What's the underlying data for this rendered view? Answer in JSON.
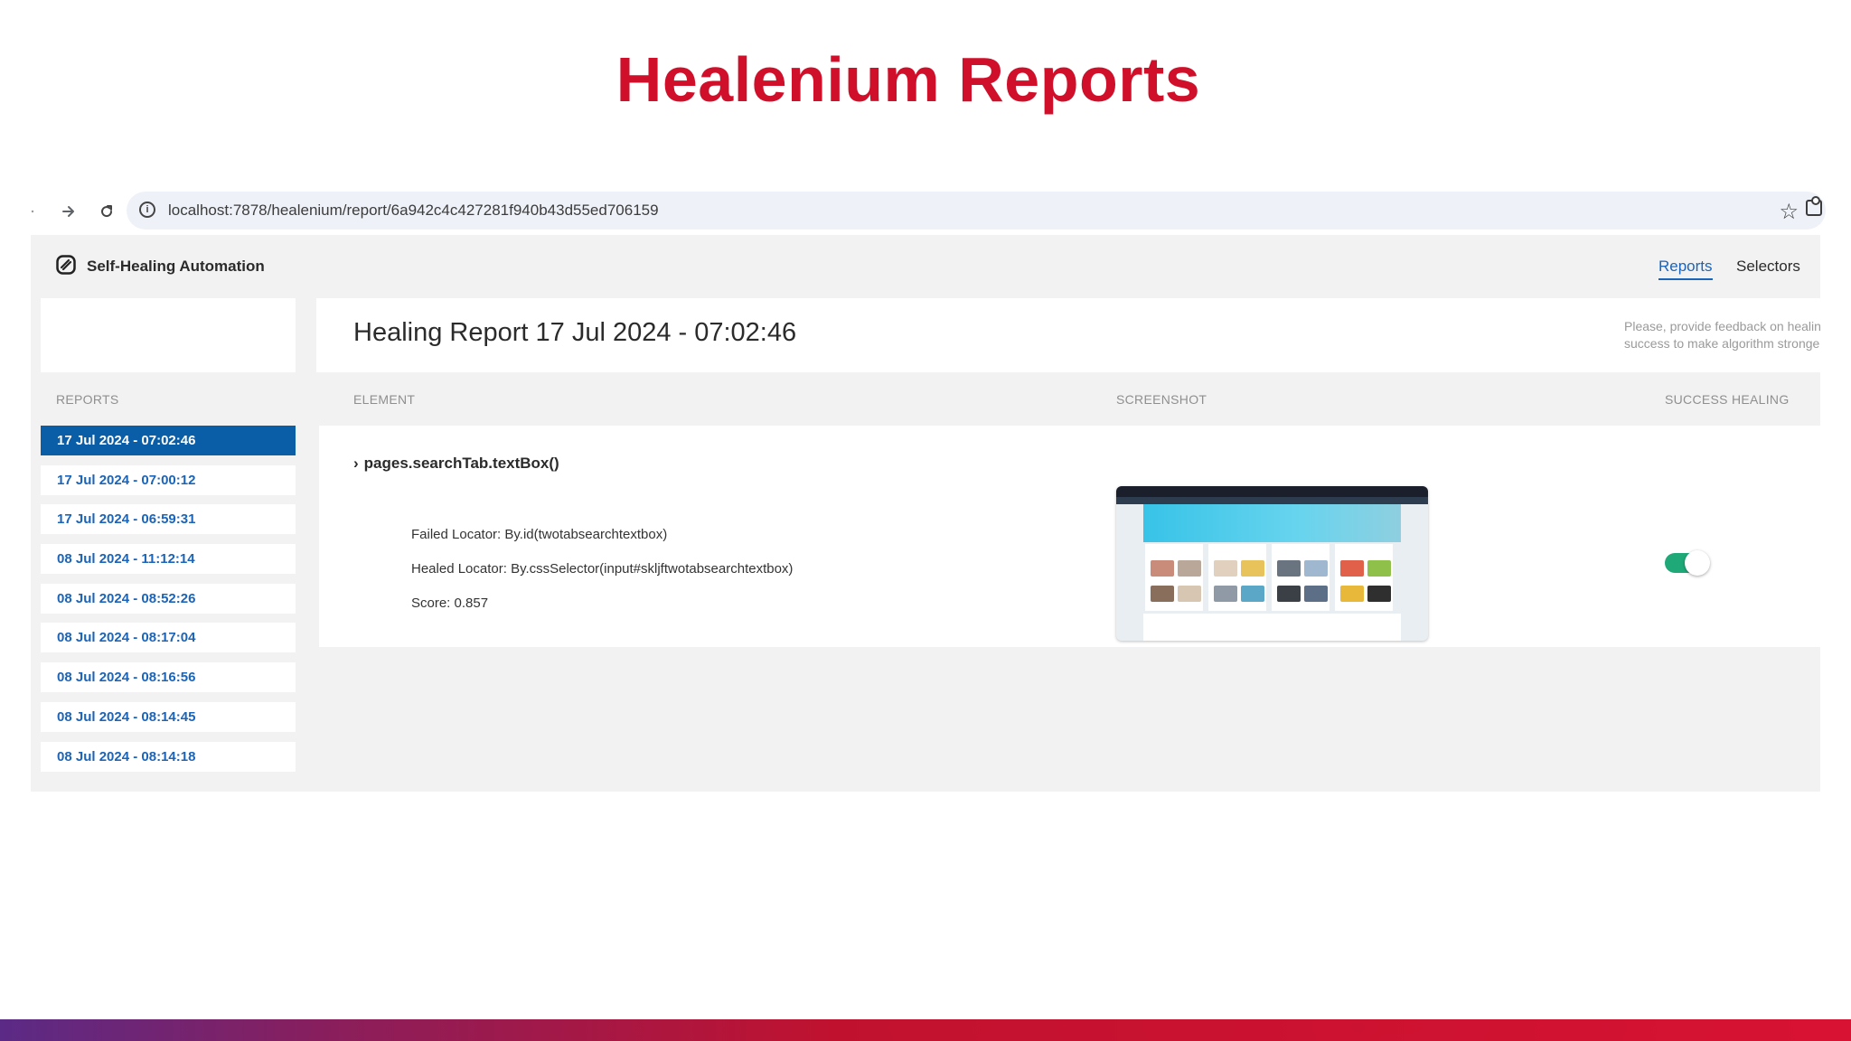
{
  "slide": {
    "title": "Healenium Reports"
  },
  "browser": {
    "url": "localhost:7878/healenium/report/6a942c4c427281f940b43d55ed706159",
    "icons": [
      "back-icon",
      "forward-icon",
      "reload-icon",
      "info-icon",
      "star-icon",
      "extensions-icon"
    ]
  },
  "app": {
    "brand": "Self-Healing Automation",
    "nav": {
      "reports": "Reports",
      "selectors": "Selectors"
    },
    "report_title": "Healing Report 17 Jul 2024 - 07:02:46",
    "feedback": {
      "line1": "Please, provide feedback on healing",
      "line2": "success to make algorithm stronger"
    },
    "columns": {
      "reports": "REPORTS",
      "element": "ELEMENT",
      "screenshot": "SCREENSHOT",
      "success": "SUCCESS HEALING"
    },
    "reports": [
      "17 Jul 2024 - 07:02:46",
      "17 Jul 2024 - 07:00:12",
      "17 Jul 2024 - 06:59:31",
      "08 Jul 2024 - 11:12:14",
      "08 Jul 2024 - 08:52:26",
      "08 Jul 2024 - 08:17:04",
      "08 Jul 2024 - 08:16:56",
      "08 Jul 2024 - 08:14:45",
      "08 Jul 2024 - 08:14:18"
    ],
    "selected_report_index": 0,
    "entry": {
      "element": "pages.searchTab.textBox()",
      "failed_locator": "Failed Locator: By.id(twotabsearchtextbox)",
      "healed_locator": "Healed Locator: By.cssSelector(input#skljftwotabsearchtextbox)",
      "score": "Score: 0.857",
      "success_healing": true
    }
  },
  "colors": {
    "title_red": "#d0102a",
    "accent_blue": "#1b64b8",
    "selected_blue": "#0a5ea8",
    "toggle_green": "#1fa979"
  }
}
